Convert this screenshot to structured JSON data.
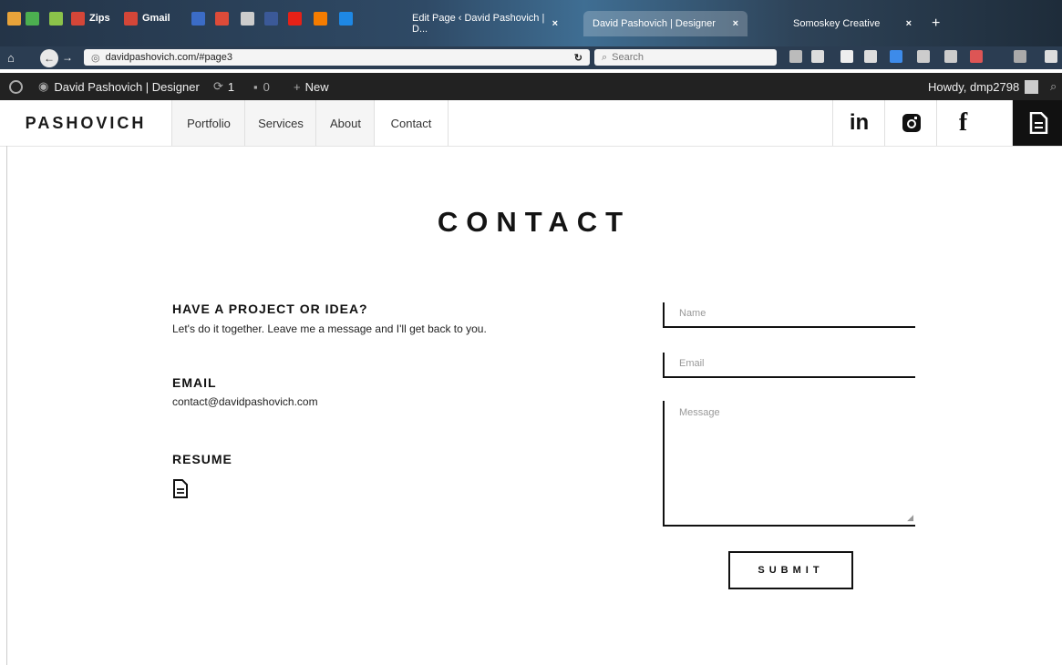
{
  "browser": {
    "bookmarks": [
      {
        "label": "",
        "color": "#e8a33a",
        "icon": "bookmark-icon"
      },
      {
        "label": "",
        "color": "#4caf50",
        "icon": "bookmark-icon"
      },
      {
        "label": "",
        "color": "#8bc34a",
        "icon": "bookmark-icon"
      },
      {
        "label": "Zips",
        "color": "#d44638",
        "icon": "gmail-icon"
      },
      {
        "label": "Gmail",
        "color": "#d44638",
        "icon": "gmail-icon"
      },
      {
        "label": "",
        "color": "#3b6cc7",
        "icon": "rss-icon"
      },
      {
        "label": "",
        "color": "#dd4b39",
        "icon": "google-plus-icon"
      },
      {
        "label": "",
        "color": "#cccccc",
        "icon": "app-icon"
      },
      {
        "label": "",
        "color": "#3b5998",
        "icon": "facebook-icon"
      },
      {
        "label": "",
        "color": "#e62117",
        "icon": "youtube-icon"
      },
      {
        "label": "",
        "color": "#f57c00",
        "icon": "blogger-icon"
      },
      {
        "label": "",
        "color": "#1e88e5",
        "icon": "app-icon"
      }
    ],
    "tabs": [
      {
        "label": "Edit Page ‹ David Pashovich | D...",
        "close": "×"
      },
      {
        "label": "David Pashovich | Designer",
        "close": "×"
      },
      {
        "label": "Somoskey Creative",
        "close": "×"
      }
    ],
    "new_tab": "+",
    "url": "davidpashovich.com/#page3",
    "search_placeholder": "Search"
  },
  "wp_admin": {
    "site_name": "David Pashovich | Designer",
    "updates": "1",
    "comments": "0",
    "new": "New",
    "howdy": "Howdy, dmp2798"
  },
  "site": {
    "logo": "PASHOVICH",
    "nav": [
      "Portfolio",
      "Services",
      "About",
      "Contact"
    ],
    "social": [
      "in",
      "f"
    ]
  },
  "content": {
    "title": "CONTACT",
    "project_heading": "HAVE A PROJECT OR IDEA?",
    "project_text": "Let's do it together. Leave me a message and I'll get back to you.",
    "email_heading": "EMAIL",
    "email_value": "contact@davidpashovich.com",
    "resume_heading": "RESUME"
  },
  "form": {
    "name_placeholder": "Name",
    "email_placeholder": "Email",
    "message_placeholder": "Message",
    "submit_label": "SUBMIT"
  }
}
